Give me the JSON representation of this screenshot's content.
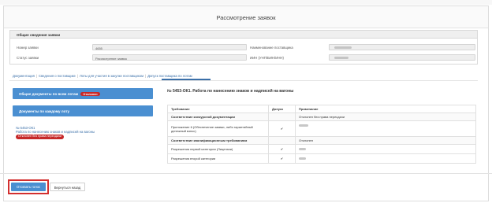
{
  "panel": {
    "title": "Рассмотрение заявок"
  },
  "info": {
    "header": "Общие сведения заявки",
    "app_number_label": "Номер заявки",
    "app_number_value": "4655",
    "status_label": "Статус заявки",
    "status_value": "Рассмотрение заявок",
    "supplier_name_label": "Наименование поставщика",
    "supplier_id_label": "ИИН (УНП/БИН/ИНН)"
  },
  "breadcrumbs": [
    "Документация",
    "Сведения о поставщике",
    "Лоты для участия в закупке поставщиком",
    "Допуск поставщика по лотам"
  ],
  "left": {
    "all_docs_label": "Общие документы по всем лотам",
    "all_docs_badge": "Отклонен",
    "per_lot_label": "Документы по каждому лоту",
    "lot_number": "№ 5453-ОК1",
    "lot_name": "Работа по нанесению знаков и надписей на вагоны",
    "lot_badge": "Отклонен без права пересдачи"
  },
  "section_title": "№ 5453-ОК1. Работа по нанесению знаков и надписей на вагоны",
  "table": {
    "headers": [
      "Требование",
      "Допуск",
      "Примечание"
    ],
    "rows": [
      {
        "req": "Соответствие конкурсной документации",
        "check": "",
        "note": "Отклонен без права пересдачи",
        "group": true
      },
      {
        "req": "Приложение 6 (Обеспечение заявки, либо гарантийный денежный взнос)",
        "check": "✔",
        "note": "",
        "group": false
      },
      {
        "req": "Соответствие квалификационным требованиям",
        "check": "",
        "note": "Отклонен",
        "group": true
      },
      {
        "req": "Разрешения первой категории (Лицензии)",
        "check": "✔",
        "note": "",
        "group": false
      },
      {
        "req": "Разрешения второй категории",
        "check": "✔",
        "note": "",
        "group": false
      }
    ]
  },
  "footer": {
    "recall_label": "Отозвать голос",
    "back_label": "Вернуться назад"
  }
}
